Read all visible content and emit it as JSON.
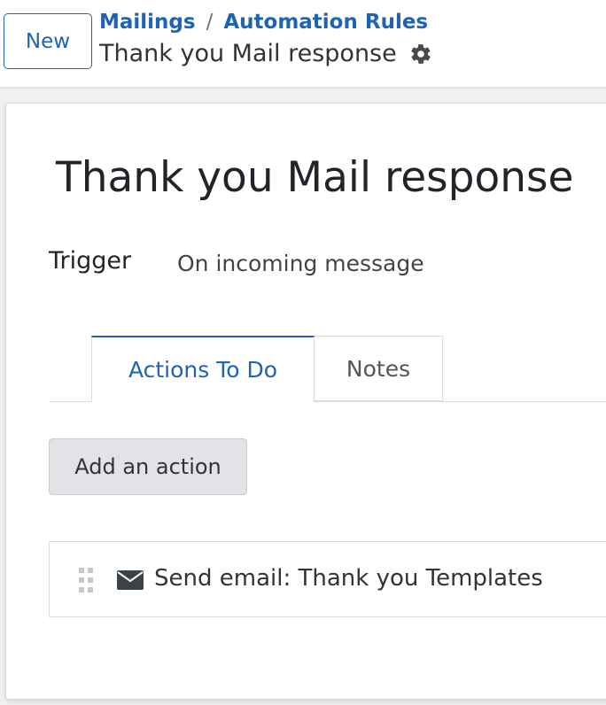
{
  "control_panel": {
    "new_button_label": "New",
    "breadcrumb": {
      "parent": "Mailings",
      "separator": "/",
      "current": "Automation Rules"
    },
    "record_name": "Thank you Mail response",
    "settings_icon": "gear-icon"
  },
  "form": {
    "title": "Thank you Mail response",
    "trigger_label": "Trigger",
    "trigger_value": "On incoming message",
    "tabs": [
      {
        "label": "Actions To Do",
        "active": true
      },
      {
        "label": "Notes",
        "active": false
      }
    ],
    "add_action_label": "Add an action",
    "actions": [
      {
        "icon": "envelope-icon",
        "label": "Send email: Thank you Templates"
      }
    ]
  },
  "colors": {
    "accent": "#1f63b7",
    "text": "#212529",
    "muted": "#444444",
    "button_bg": "#e1e3e6",
    "border": "#dcdcdc"
  }
}
